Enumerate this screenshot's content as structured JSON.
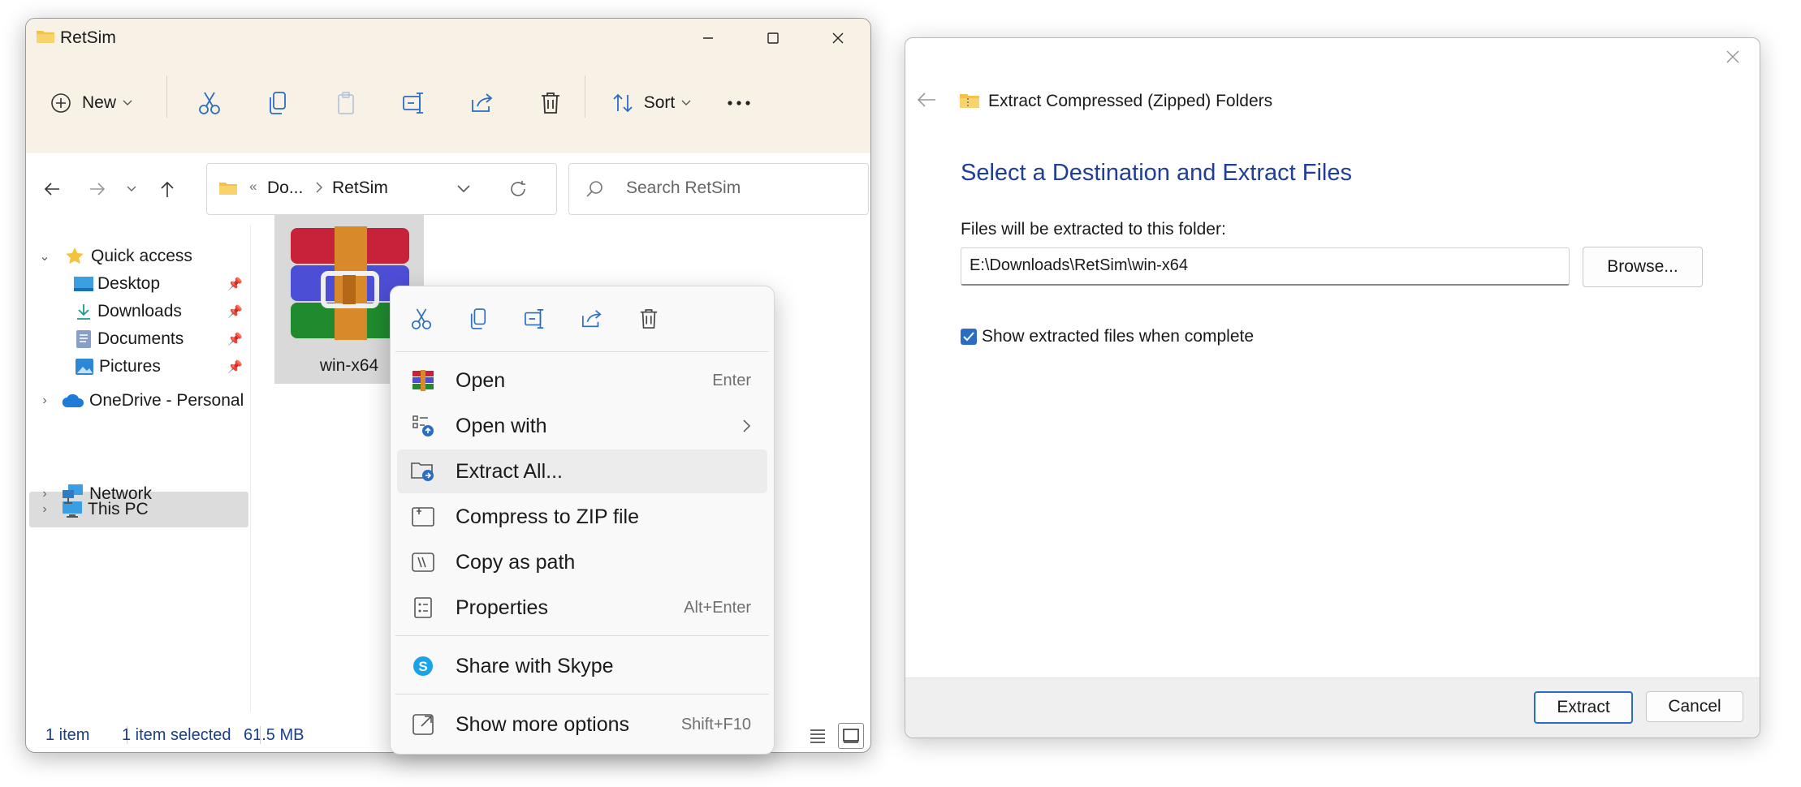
{
  "explorer": {
    "title": "RetSim",
    "toolbar": {
      "new_label": "New",
      "sort_label": "Sort"
    },
    "address": {
      "overflow": "«",
      "crumbs": [
        "Do...",
        "RetSim"
      ]
    },
    "search": {
      "placeholder": "Search RetSim"
    },
    "nav": [
      {
        "label": "Quick access",
        "icon": "star-icon"
      },
      {
        "label": "Desktop",
        "icon": "desktop-icon"
      },
      {
        "label": "Downloads",
        "icon": "downloads-icon"
      },
      {
        "label": "Documents",
        "icon": "documents-icon"
      },
      {
        "label": "Pictures",
        "icon": "pictures-icon"
      },
      {
        "label": "OneDrive - Personal",
        "icon": "onedrive-icon"
      },
      {
        "label": "This PC",
        "icon": "this-pc-icon"
      },
      {
        "label": "Network",
        "icon": "network-icon"
      }
    ],
    "file": {
      "name": "win-x64",
      "icon": "winrar-archive-icon"
    },
    "status": {
      "count": "1 item",
      "selected": "1 item selected",
      "size": "61.5 MB"
    }
  },
  "context_menu": {
    "items": [
      {
        "label": "Open",
        "shortcut": "Enter"
      },
      {
        "label": "Open with",
        "shortcut": ""
      },
      {
        "label": "Extract All...",
        "shortcut": ""
      },
      {
        "label": "Compress to ZIP file",
        "shortcut": ""
      },
      {
        "label": "Copy as path",
        "shortcut": ""
      },
      {
        "label": "Properties",
        "shortcut": "Alt+Enter"
      },
      {
        "label": "Share with Skype",
        "shortcut": ""
      },
      {
        "label": "Show more options",
        "shortcut": "Shift+F10"
      }
    ]
  },
  "dialog": {
    "window_title": "Extract Compressed (Zipped) Folders",
    "heading": "Select a Destination and Extract Files",
    "path_label": "Files will be extracted to this folder:",
    "path_value": "E:\\Downloads\\RetSim\\win-x64",
    "browse_label": "Browse...",
    "checkbox_label": "Show extracted files when complete",
    "checkbox_checked": true,
    "extract_label": "Extract",
    "cancel_label": "Cancel"
  },
  "colors": {
    "accent": "#2b6cc4",
    "heading": "#1f3d99",
    "titlebar": "#f8f1e6",
    "folder": "#f4c24a"
  }
}
